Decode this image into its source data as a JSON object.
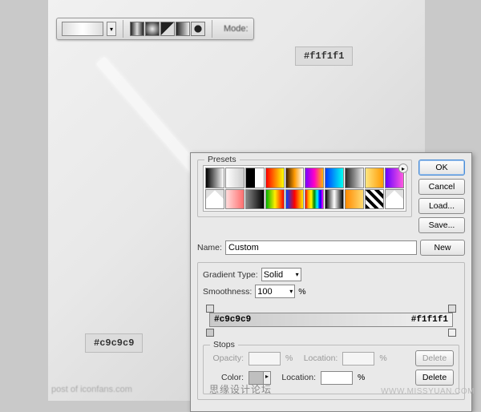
{
  "canvas": {
    "top_right_color": "#f1f1f1",
    "bottom_left_color": "#c9c9c9"
  },
  "toolbar": {
    "mode_label": "Mode:"
  },
  "dialog": {
    "presets_title": "Presets",
    "buttons": {
      "ok": "OK",
      "cancel": "Cancel",
      "load": "Load...",
      "save": "Save...",
      "new": "New"
    },
    "name_label": "Name:",
    "name_value": "Custom",
    "gtype_label": "Gradient Type:",
    "gtype_value": "Solid",
    "smooth_label": "Smoothness:",
    "smooth_value": "100",
    "percent": "%",
    "stops_title": "Stops",
    "opacity_label": "Opacity:",
    "location_label": "Location:",
    "color_label": "Color:",
    "delete_label": "Delete",
    "left_stop_label": "#c9c9c9",
    "right_stop_label": "#f1f1f1",
    "swatches": [
      "linear-gradient(90deg,#000,#fff)",
      "linear-gradient(90deg,#fff,#ccc)",
      "linear-gradient(90deg,#000,#000 50%,#fff 50%)",
      "linear-gradient(90deg,#ff0000,#ffff00)",
      "linear-gradient(90deg,#3d1f00,#ff9a00,#fff)",
      "linear-gradient(90deg,#7a00ff,#ff00c8,#ffb400)",
      "linear-gradient(90deg,#003cff,#00fff2)",
      "linear-gradient(90deg,#2a2a2a,#888,#eee)",
      "linear-gradient(90deg,#ffe680,#ff9a00)",
      "linear-gradient(90deg,#6a00ff,#ff5ae0)",
      "linear-gradient(135deg,#e0e0e0 25%,transparent 25%),linear-gradient(225deg,#e0e0e0 25%,#fff 25%)",
      "linear-gradient(90deg,#ffdcdc,#ff6e6e)",
      "linear-gradient(90deg,#888,#000)",
      "linear-gradient(90deg,#00b300,#ffee00,#ff0000)",
      "linear-gradient(90deg,#0042ff,#ff0000,#ffee00)",
      "linear-gradient(90deg,red,orange,yellow,green,cyan,blue,magenta)",
      "linear-gradient(90deg,#000,#555,#aaa,#fff,#aaa,#555,#000)",
      "linear-gradient(90deg,#ff8a00,#ffdc73)",
      "repeating-linear-gradient(45deg,#000 0 4px,#fff 4px 8px)",
      "linear-gradient(135deg,#e0e0e0 25%,transparent 25%),linear-gradient(225deg,#e0e0e0 25%,#fff 25%)"
    ]
  },
  "footer": {
    "post": "post of iconfans.com",
    "center": "思缘设计论坛",
    "url": "WWW.MISSYUAN.COM"
  }
}
